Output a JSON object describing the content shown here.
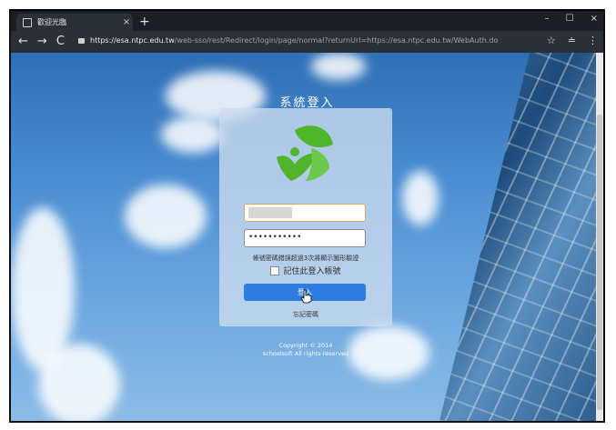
{
  "browser": {
    "tab_title": "歡迎光臨",
    "tab_close": "×",
    "new_tab": "+",
    "window_controls": [
      "–",
      "☐",
      "×"
    ],
    "nav": {
      "back": "←",
      "forward": "→",
      "reload": "C"
    },
    "url_host": "https://esa.ntpc.edu.tw",
    "url_rest": "/web-sso/rest/Redirect/login/page/normal?returnUrl=https://esa.ntpc.edu.tw/WebAuth.do",
    "star": "☆",
    "extensions": "≐",
    "menu": "⋮"
  },
  "login": {
    "title": "系統登入",
    "password_value": "•••••••••••",
    "hint": "帳號密碼錯誤超過3次將顯示圖形驗證",
    "remember_label": "記住此登入帳號",
    "login_button": "登入",
    "forgot": "忘記密碼",
    "copyright_line1": "Copyright © 2014",
    "copyright_line2": "schoolsoft All rights reserved"
  },
  "colors": {
    "login_button": "#2f7de1",
    "username_border": "#e3a35b",
    "logo_green": "#4fb52a"
  }
}
